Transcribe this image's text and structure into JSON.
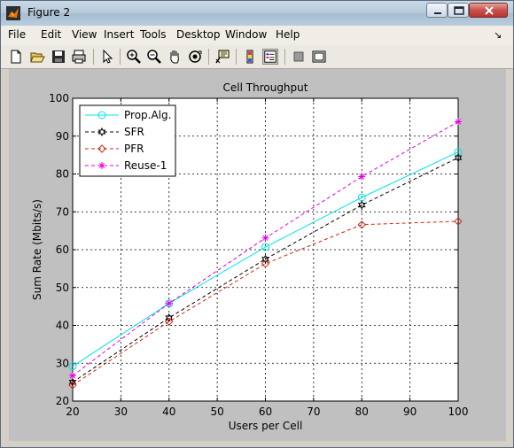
{
  "window": {
    "title": "Figure 2",
    "title_icon": "matlab-logo-icon",
    "controls": [
      "minimize-icon",
      "maximize-icon",
      "close-icon"
    ]
  },
  "menubar": {
    "items": [
      "File",
      "Edit",
      "View",
      "Insert",
      "Tools",
      "Desktop",
      "Window",
      "Help"
    ]
  },
  "toolbar": {
    "icons": [
      "new-figure-icon",
      "open-file-icon",
      "save-icon",
      "print-icon",
      "edit-plot-arrow-icon",
      "zoom-in-icon",
      "zoom-out-icon",
      "pan-hand-icon",
      "rotate-3d-icon",
      "data-cursor-icon",
      "colorbar-icon",
      "legend-icon",
      "hide-plot-tools-icon",
      "show-plot-tools-icon"
    ]
  },
  "colors": {
    "figure_bg": "#c0c0c0",
    "axes_bg": "#ffffff",
    "prop_alg": "#00e5e5",
    "sfr": "#000000",
    "pfr": "#cc2a1a",
    "reuse": "#e600e6"
  },
  "chart_data": {
    "type": "line",
    "title": "Cell Throughput",
    "xlabel": "Users per Cell",
    "ylabel": "Sum Rate (Mbits/s)",
    "xlim": [
      20,
      100
    ],
    "ylim": [
      20,
      100
    ],
    "xticks": [
      20,
      30,
      40,
      50,
      60,
      70,
      80,
      90,
      100
    ],
    "yticks": [
      20,
      30,
      40,
      50,
      60,
      70,
      80,
      90,
      100
    ],
    "grid": true,
    "legend_position": "top-left",
    "x": [
      20,
      40,
      60,
      80,
      100
    ],
    "series": [
      {
        "name": "Prop.Alg.",
        "values": [
          29.2,
          45.8,
          60.7,
          73.8,
          85.8
        ],
        "color": "#00e5e5",
        "line": "solid",
        "marker": "circle"
      },
      {
        "name": "SFR",
        "values": [
          25.0,
          42.0,
          57.5,
          71.8,
          84.3
        ],
        "color": "#000000",
        "line": "dashed",
        "marker": "hexagram"
      },
      {
        "name": "PFR",
        "values": [
          24.2,
          41.0,
          56.3,
          66.6,
          67.5
        ],
        "color": "#cc2a1a",
        "line": "dashed",
        "marker": "diamond"
      },
      {
        "name": "Reuse-1",
        "values": [
          26.7,
          45.8,
          63.1,
          79.3,
          93.8
        ],
        "color": "#e600e6",
        "line": "dashed",
        "marker": "star"
      }
    ]
  }
}
